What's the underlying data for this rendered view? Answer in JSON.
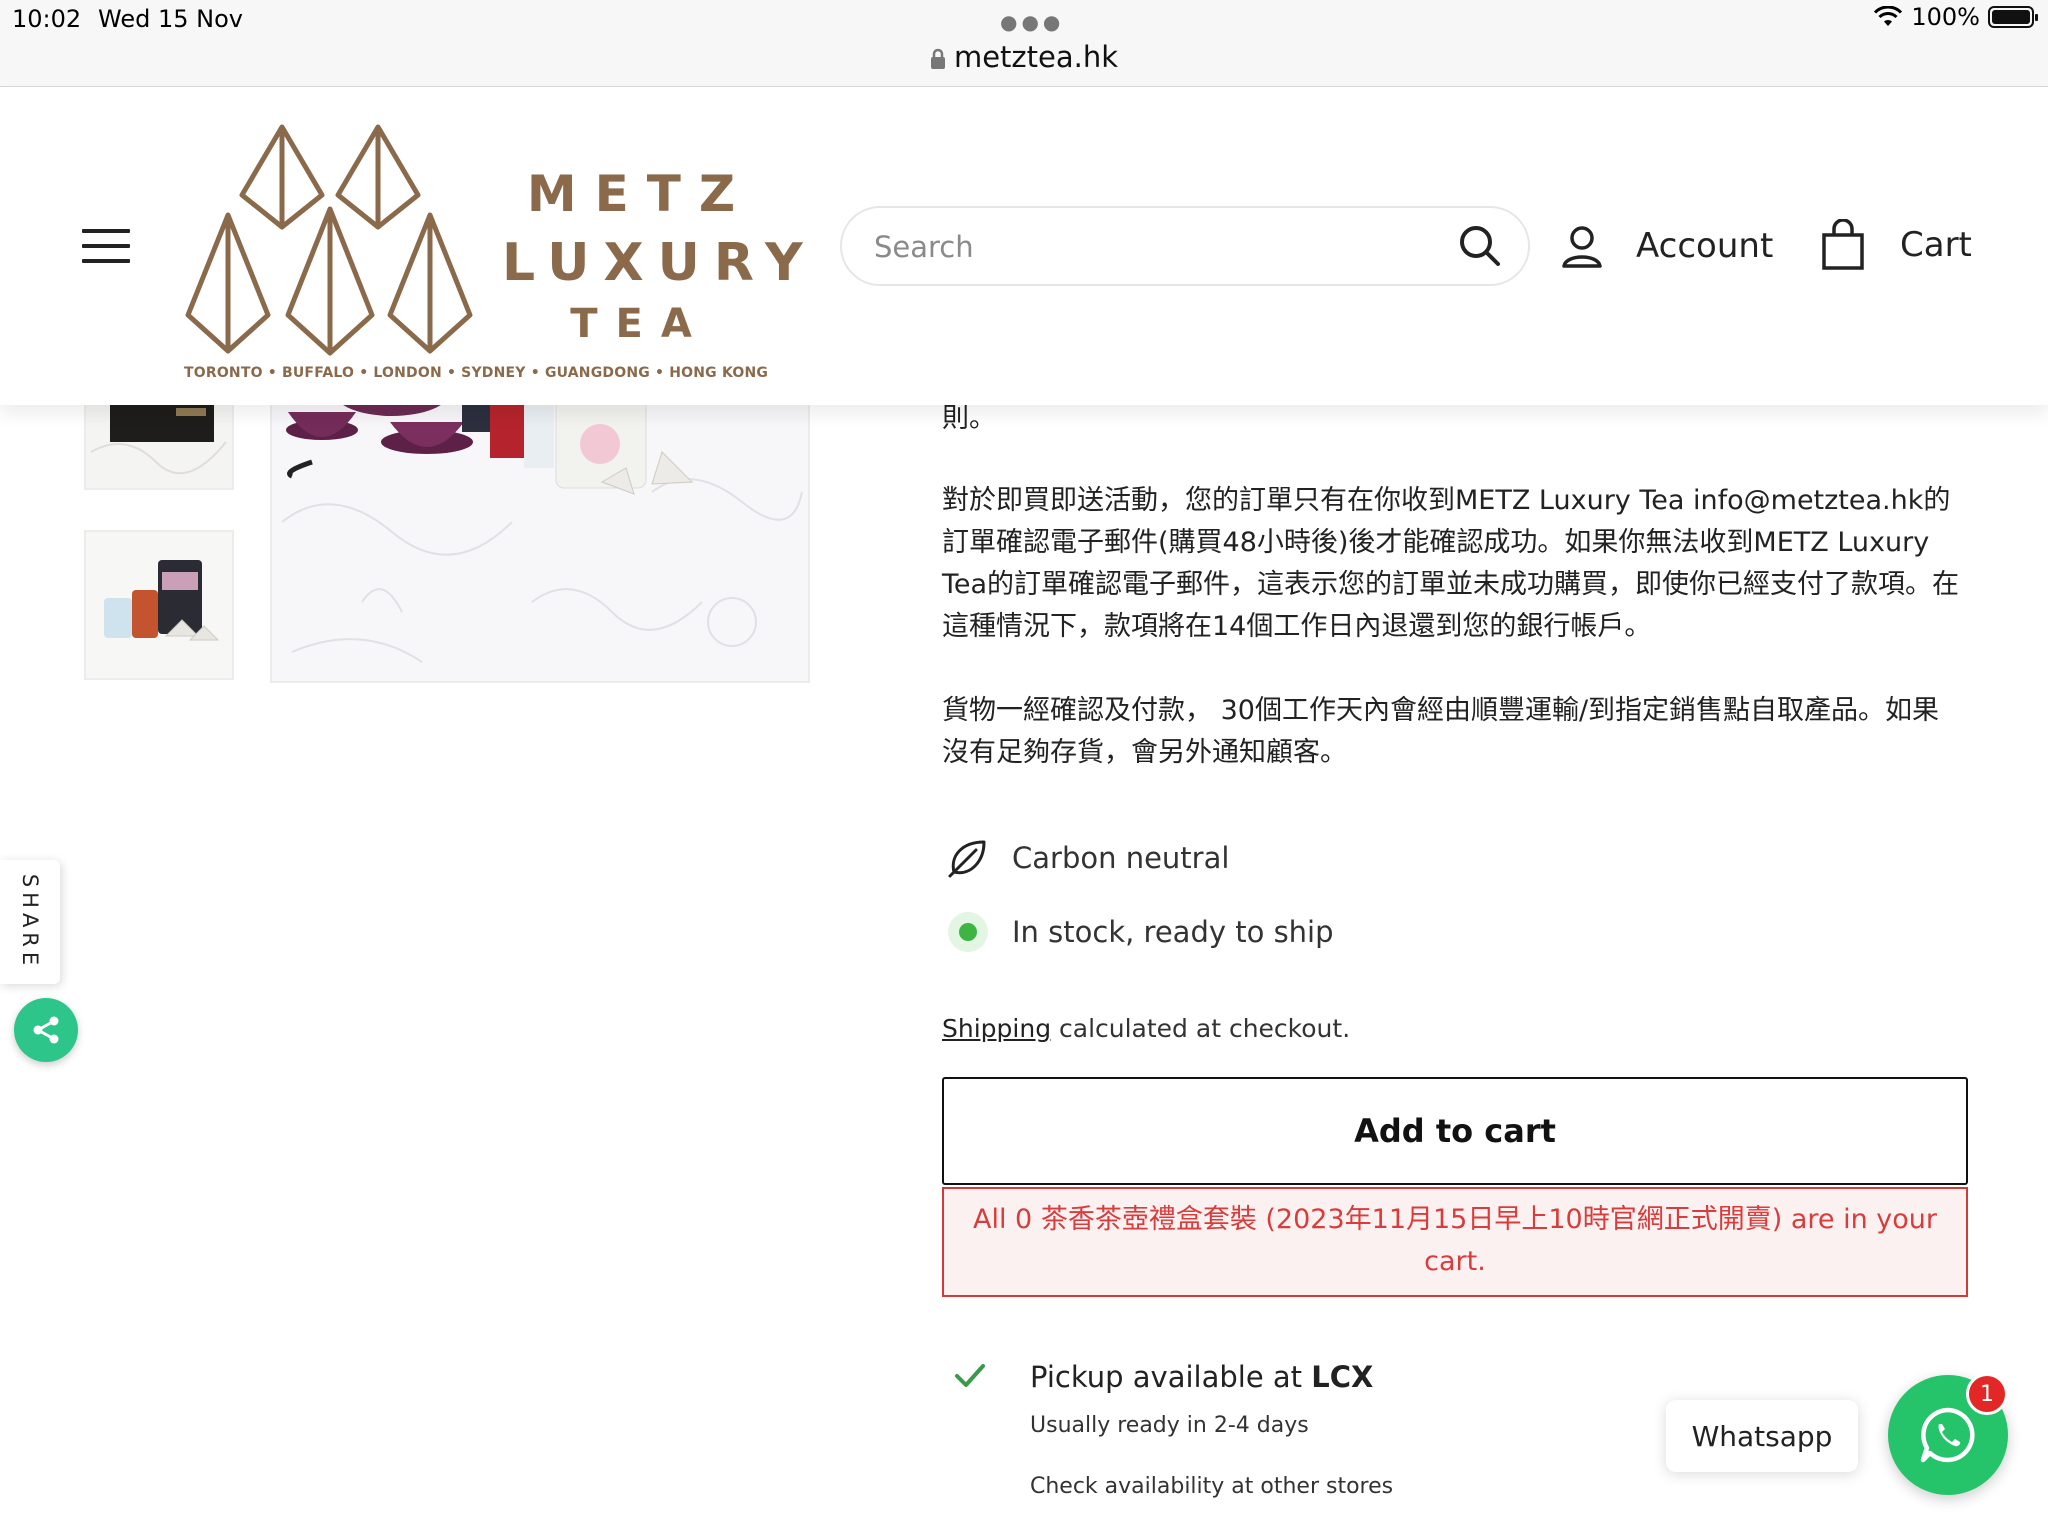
{
  "status_bar": {
    "time": "10:02",
    "date": "Wed 15 Nov",
    "battery": "100%"
  },
  "browser": {
    "url": "metztea.hk"
  },
  "header": {
    "logo": {
      "line1": "METZ",
      "line2": "LUXURY",
      "line3": "TEA",
      "tagline": "TORONTO • BUFFALO • LONDON • SYDNEY • GUANGDONG • HONG KONG"
    },
    "search_placeholder": "Search",
    "account_label": "Account",
    "cart_label": "Cart"
  },
  "share": {
    "label": "SHARE"
  },
  "content": {
    "paragraph_top": "則。",
    "paragraph_1": "對於即買即送活動，您的訂單只有在你收到METZ Luxury Tea info@metztea.hk的訂單確認電子郵件(購買48小時後)後才能確認成功。如果你無法收到METZ Luxury Tea的訂單確認電子郵件，這表示您的訂單並未成功購買，即使你已經支付了款項。在這種情況下，款項將在14個工作日內退還到您的銀行帳戶。",
    "paragraph_2": "貨物一經確認及付款， 30個工作天內會經由順豐運輸/到指定銷售點自取產品。如果沒有足夠存貨，會另外通知顧客。",
    "features": [
      {
        "icon": "leaf-icon",
        "text": "Carbon neutral"
      },
      {
        "icon": "in-stock-dot-icon",
        "text": "In stock, ready to ship"
      }
    ],
    "shipping_link": "Shipping",
    "shipping_rest": " calculated at checkout.",
    "add_to_cart_label": "Add to cart",
    "cart_error": "All 0 茶香茶壺禮盒套裝 (2023年11月15日早上10時官網正式開賣) are in your cart.",
    "pickup": {
      "prefix": "Pickup available at ",
      "store": "LCX",
      "ready": "Usually ready in 2-4 days",
      "check_link": "Check availability at other stores"
    }
  },
  "whatsapp": {
    "label": "Whatsapp",
    "badge_count": "1"
  },
  "colors": {
    "brand_brown": "#8b6a4c",
    "error_red": "#d93c3c",
    "whatsapp_green": "#26c46a",
    "share_green": "#2dc58a",
    "stock_green": "#3cb543"
  }
}
